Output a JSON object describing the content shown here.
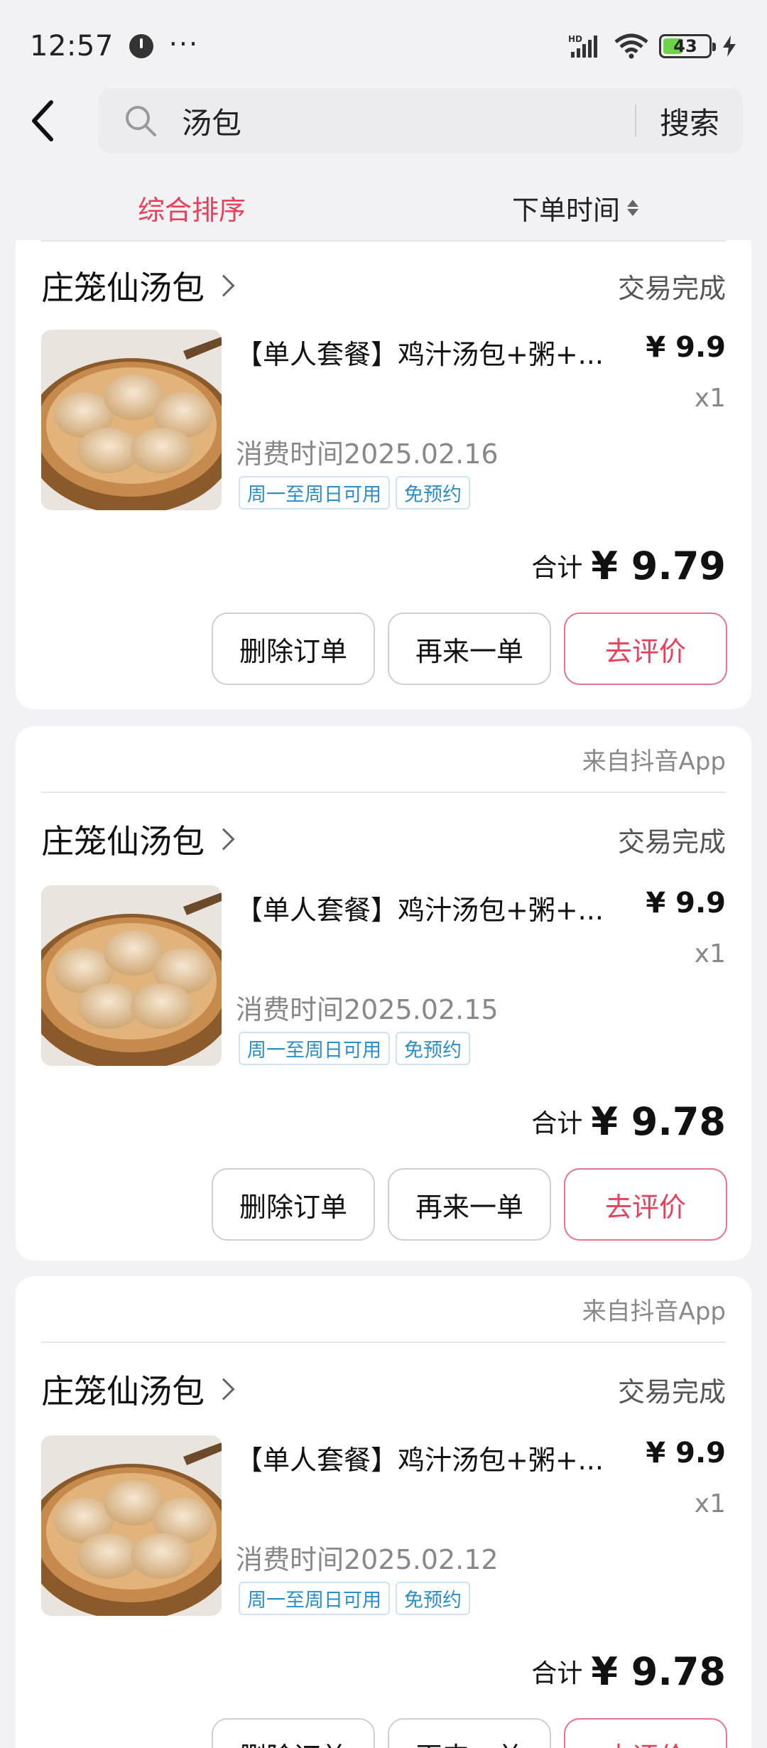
{
  "status_bar": {
    "time": "12:57",
    "more": "···",
    "battery": "43",
    "battery_level": 0.43,
    "icons": [
      "clock-icon",
      "hd-signal-icon",
      "wifi-icon",
      "battery-icon",
      "charging-icon"
    ]
  },
  "header": {
    "search_value": "汤包",
    "search_button": "搜索"
  },
  "sort": {
    "comprehensive": "综合排序",
    "order_time": "下单时间"
  },
  "colors": {
    "accent": "#e8405a",
    "tag_blue": "#2a8ec8"
  },
  "orders": [
    {
      "source": "",
      "shop": "庄笼仙汤包",
      "status": "交易完成",
      "title": "【单人套餐】鸡汁汤包+粥+...",
      "price": "¥ 9.9",
      "qty": "x1",
      "time": "消费时间2025.02.16",
      "tags": [
        "周一至周日可用",
        "免预约"
      ],
      "total_label": "合计",
      "total": "¥ 9.79",
      "buttons": [
        "删除订单",
        "再来一单",
        "去评价"
      ]
    },
    {
      "source": "来自抖音App",
      "shop": "庄笼仙汤包",
      "status": "交易完成",
      "title": "【单人套餐】鸡汁汤包+粥+...",
      "price": "¥ 9.9",
      "qty": "x1",
      "time": "消费时间2025.02.15",
      "tags": [
        "周一至周日可用",
        "免预约"
      ],
      "total_label": "合计",
      "total": "¥ 9.78",
      "buttons": [
        "删除订单",
        "再来一单",
        "去评价"
      ]
    },
    {
      "source": "来自抖音App",
      "shop": "庄笼仙汤包",
      "status": "交易完成",
      "title": "【单人套餐】鸡汁汤包+粥+...",
      "price": "¥ 9.9",
      "qty": "x1",
      "time": "消费时间2025.02.12",
      "tags": [
        "周一至周日可用",
        "免预约"
      ],
      "total_label": "合计",
      "total": "¥ 9.78",
      "buttons": [
        "删除订单",
        "再来一单",
        "去评价"
      ]
    }
  ]
}
